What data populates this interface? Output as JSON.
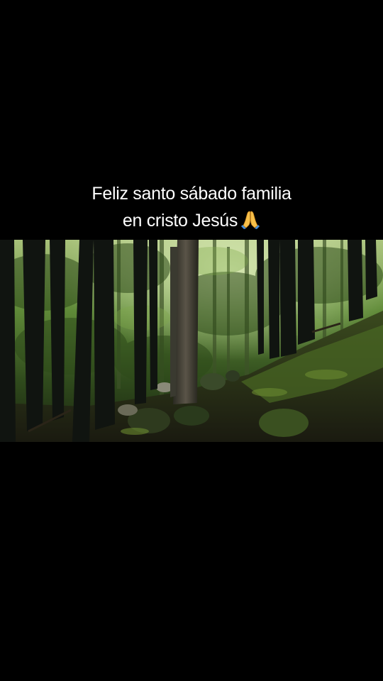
{
  "caption": {
    "line1": "Feliz santo sábado familia",
    "line2": "en cristo Jesús"
  },
  "emoji": "folded-hands-icon",
  "colors": {
    "background": "#000000",
    "text": "#ffffff",
    "foliage": "#5a7a34",
    "trunk_dark": "#141810",
    "moss": "#3d5a1e"
  }
}
